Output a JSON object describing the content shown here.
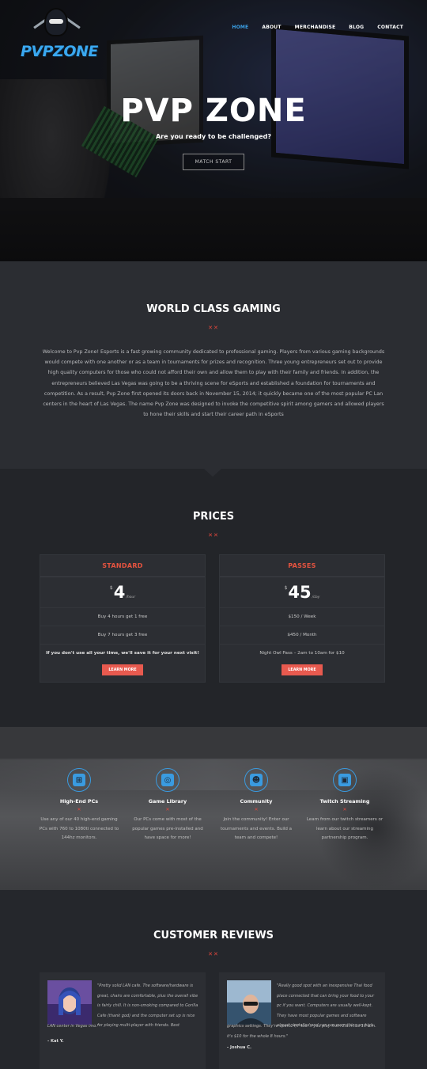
{
  "brand": {
    "logo_text": "PVPZONE"
  },
  "nav": {
    "items": [
      "HOME",
      "ABOUT",
      "MERCHANDISE",
      "BLOG",
      "CONTACT"
    ],
    "active_index": 0
  },
  "hero": {
    "title": "PVP ZONE",
    "subtitle": "Are you ready to be challenged?",
    "button": "MATCH START"
  },
  "about": {
    "title": "WORLD CLASS GAMING",
    "divider": "✕✕",
    "body": "Welcome to Pvp Zone! Esports is a fast growing community dedicated to professional gaming. Players from various gaming backgrounds would compete with one another or as a team in tournaments for prizes and recognition. Three young entrepreneurs set out to provide high quality computers for those who could not afford their own and allow them to play with their family and friends. In addition, the entrepreneurs believed Las Vegas was going to be a thriving scene for eSports and established a foundation for tournaments and competition. As a result, Pvp Zone first opened its doors back in November 15, 2014; it quickly became one of the most popular PC Lan centers in the heart of Las Vegas. The name Pvp Zone was designed to invoke the competitive spirit among gamers and allowed players to hone their skills and start their career path in eSports"
  },
  "prices": {
    "title": "PRICES",
    "divider": "✕✕",
    "plans": [
      {
        "name": "STANDARD",
        "currency": "$",
        "amount": "4",
        "period": "/hour",
        "rows": [
          "Buy 4 hours get 1 free",
          "Buy 7 hours get 3 free",
          "If you don't use all your time, we'll save it for your next visit!"
        ],
        "button": "LEARN MORE"
      },
      {
        "name": "PASSES",
        "currency": "$",
        "amount": "45",
        "period": "/day",
        "rows": [
          "$150 / Week",
          "$450 / Month",
          "Night Owl Pass – 2am to 10am for $10"
        ],
        "button": "LEARN MORE"
      }
    ]
  },
  "features": [
    {
      "icon": "windows-icon",
      "glyph": "⊞",
      "title": "High-End PCs",
      "divider": "✕",
      "desc": "Use any of our 40 high-end gaming PCs with 760 to 1080ti connected to 144hz monitors."
    },
    {
      "icon": "steam-icon",
      "glyph": "◎",
      "title": "Game Library",
      "divider": "✕",
      "desc": "Our PCs come with most of the popular games pre-installed and have space for more!"
    },
    {
      "icon": "community-icon",
      "glyph": "☻",
      "title": "Community",
      "divider": "✕",
      "desc": "Join the community! Enter our tournaments and events. Build a team and compete!"
    },
    {
      "icon": "twitch-icon",
      "glyph": "▣",
      "title": "Twitch Streaming",
      "divider": "✕",
      "desc": "Learn from our twitch streamers or learn about our streaming partnership program."
    }
  ],
  "reviews": {
    "title": "CUSTOMER REVIEWS",
    "divider": "✕✕",
    "items": [
      {
        "quote_top": "\"Pretty solid LAN cafe. The software/hardware is great, chairs are comfortable, plus the overall vibe is fairly chill. It is non-smoking compared to Gorilla Cafe (thank god) and the computer set up is nice for playing multi-player with friends. Best",
        "quote_bottom": "LAN center in Vegas imo.\"",
        "author": "- Kat Y."
      },
      {
        "quote_top": "\"Really good spot with an inexpensive Thai food place connected that can bring your food to your pc if you want. Computers are usually well-kept. They have most popular games and software already installed and can run everything on high",
        "quote_bottom": "graphics settings. They're open 24/7 too. If you play from 2 a.m. to 10 a.m. it's $10 for the whole 8 hours.\"",
        "author": "- Joshua C."
      }
    ]
  }
}
